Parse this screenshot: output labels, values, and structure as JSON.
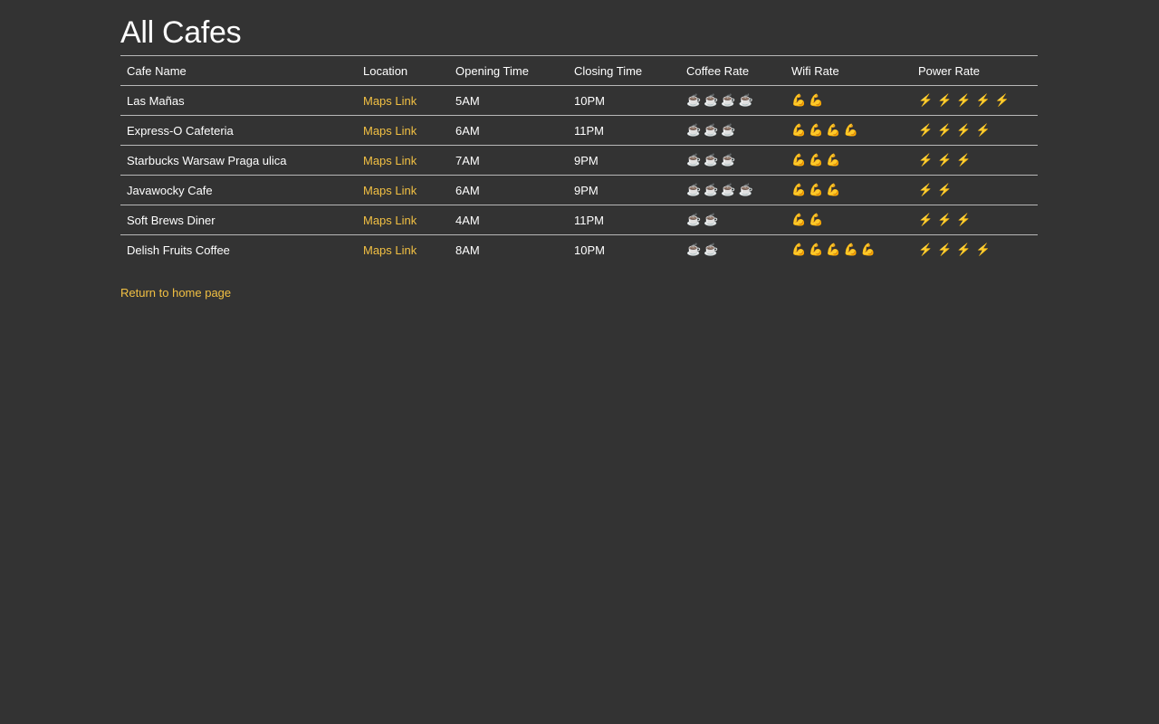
{
  "page": {
    "title": "All Cafes",
    "home_link": "Return to home page"
  },
  "colors": {
    "background": "#333333",
    "text": "#ffffff",
    "link": "#f2c043",
    "border": "#b8b8b8"
  },
  "icons": {
    "coffee": "coffee-cup-icon",
    "wifi": "flexed-biceps-icon",
    "power": "lightning-bolt-icon"
  },
  "table": {
    "headers": [
      "Cafe Name",
      "Location",
      "Opening Time",
      "Closing Time",
      "Coffee Rate",
      "Wifi Rate",
      "Power Rate"
    ],
    "rows": [
      {
        "name": "Las Mañas",
        "location": "Maps Link",
        "open": "5AM",
        "close": "10PM",
        "coffee": 4,
        "wifi": 2,
        "power": 5
      },
      {
        "name": "Express-O Cafeteria",
        "location": "Maps Link",
        "open": "6AM",
        "close": "11PM",
        "coffee": 3,
        "wifi": 4,
        "power": 4
      },
      {
        "name": "Starbucks Warsaw Praga ulica",
        "location": "Maps Link",
        "open": "7AM",
        "close": "9PM",
        "coffee": 3,
        "wifi": 3,
        "power": 3
      },
      {
        "name": "Javawocky Cafe",
        "location": "Maps Link",
        "open": "6AM",
        "close": "9PM",
        "coffee": 4,
        "wifi": 3,
        "power": 2
      },
      {
        "name": "Soft Brews Diner",
        "location": "Maps Link",
        "open": "4AM",
        "close": "11PM",
        "coffee": 2,
        "wifi": 2,
        "power": 3
      },
      {
        "name": "Delish Fruits Coffee",
        "location": "Maps Link",
        "open": "8AM",
        "close": "10PM",
        "coffee": 2,
        "wifi": 5,
        "power": 4
      }
    ]
  }
}
